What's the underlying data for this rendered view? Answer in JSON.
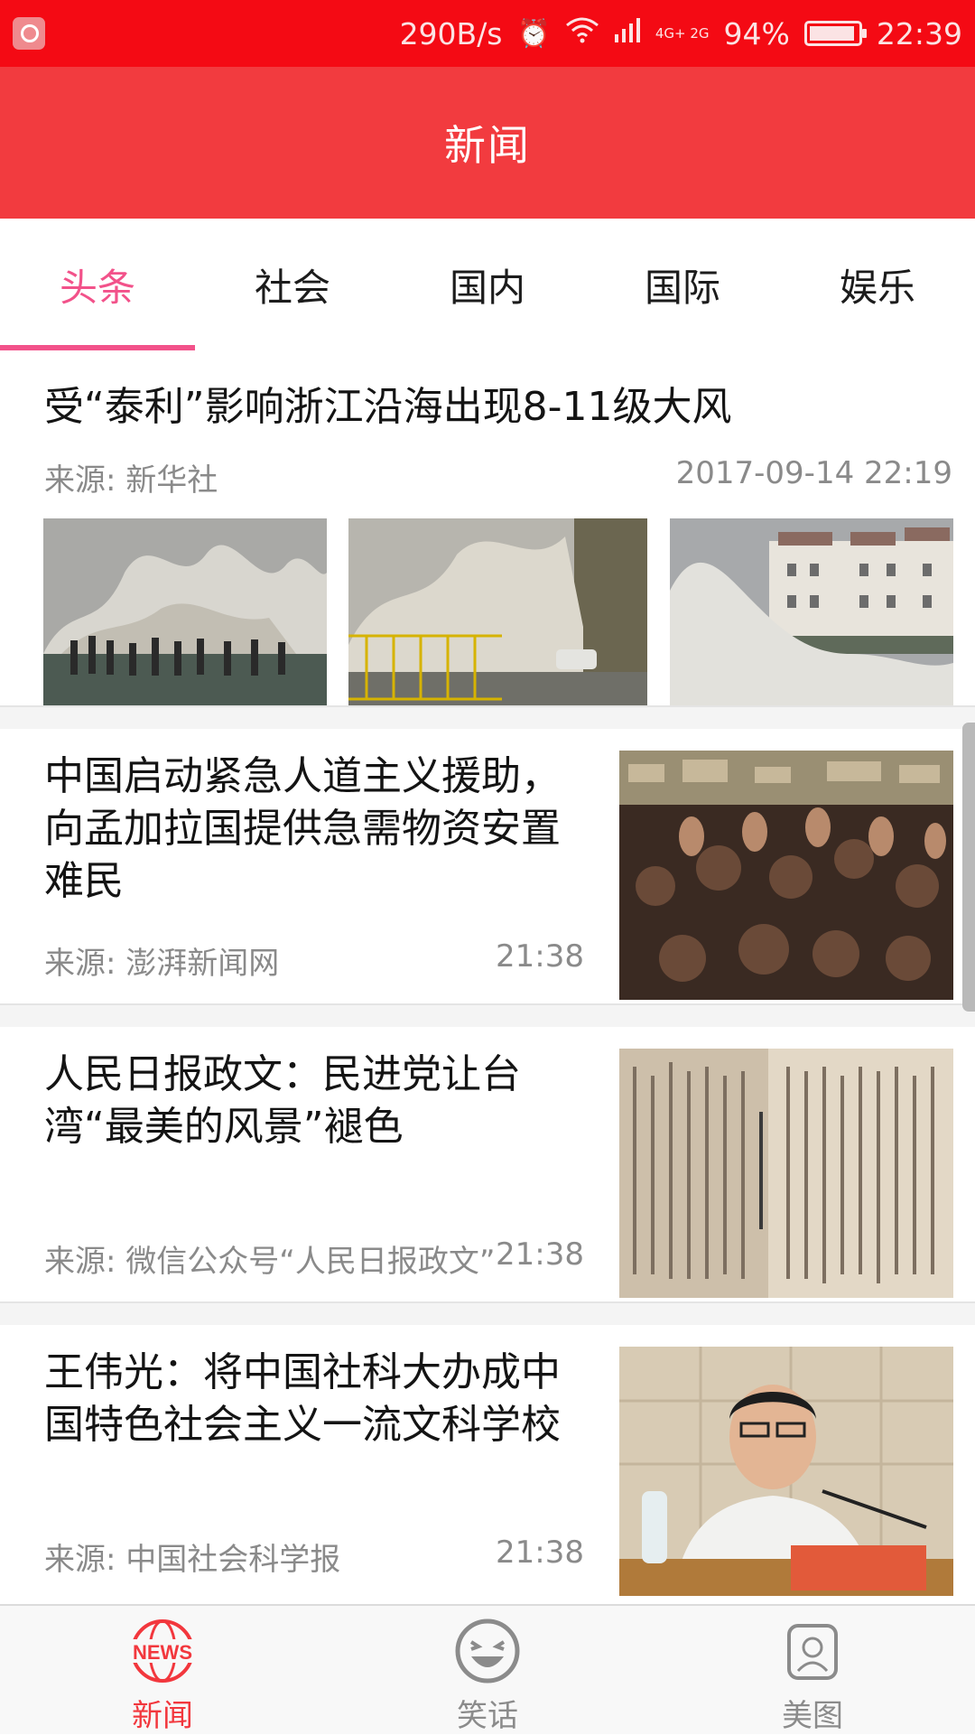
{
  "status_bar": {
    "speed": "290B/s",
    "network": "4G+ 2G",
    "battery": "94%",
    "time": "22:39"
  },
  "header": {
    "title": "新闻"
  },
  "tabs": [
    {
      "label": "头条",
      "active": true
    },
    {
      "label": "社会"
    },
    {
      "label": "国内"
    },
    {
      "label": "国际"
    },
    {
      "label": "娱乐"
    }
  ],
  "feed": {
    "top": {
      "title": "受“泰利”影响浙江沿海出现8-11级大风",
      "source": "来源: 新华社",
      "time": "2017-09-14 22:19",
      "images": [
        "typhoon-waves-crowd",
        "typhoon-waves-car",
        "typhoon-waves-buildings"
      ]
    },
    "items": [
      {
        "title": "中国启动紧急人道主义援助，向孟加拉国提供急需物资安置难民",
        "source": "来源: 澎湃新闻网",
        "time": "21:38",
        "thumb": "refugee-crowd-photo"
      },
      {
        "title": "人民日报政文：民进党让台湾“最美的风景”褪色",
        "source": "来源: 微信公众号“人民日报政文”",
        "time": "21:38",
        "thumb": "old-book-pages-photo"
      },
      {
        "title": "王伟光：将中国社科大办成中国特色社会主义一流文科学校",
        "source": "来源: 中国社会科学报",
        "time": "21:38",
        "thumb": "speaker-at-podium-photo"
      }
    ]
  },
  "bottom_nav": [
    {
      "label": "新闻",
      "icon": "news-globe-icon",
      "active": true
    },
    {
      "label": "笑话",
      "icon": "laughing-face-icon"
    },
    {
      "label": "美图",
      "icon": "picture-frame-icon"
    }
  ],
  "colors": {
    "status_bar": "#f40a14",
    "header": "#f23b3f",
    "tab_active": "#f2528a",
    "nav_active": "#f2373d",
    "nav_inactive": "#8b8b8b"
  }
}
